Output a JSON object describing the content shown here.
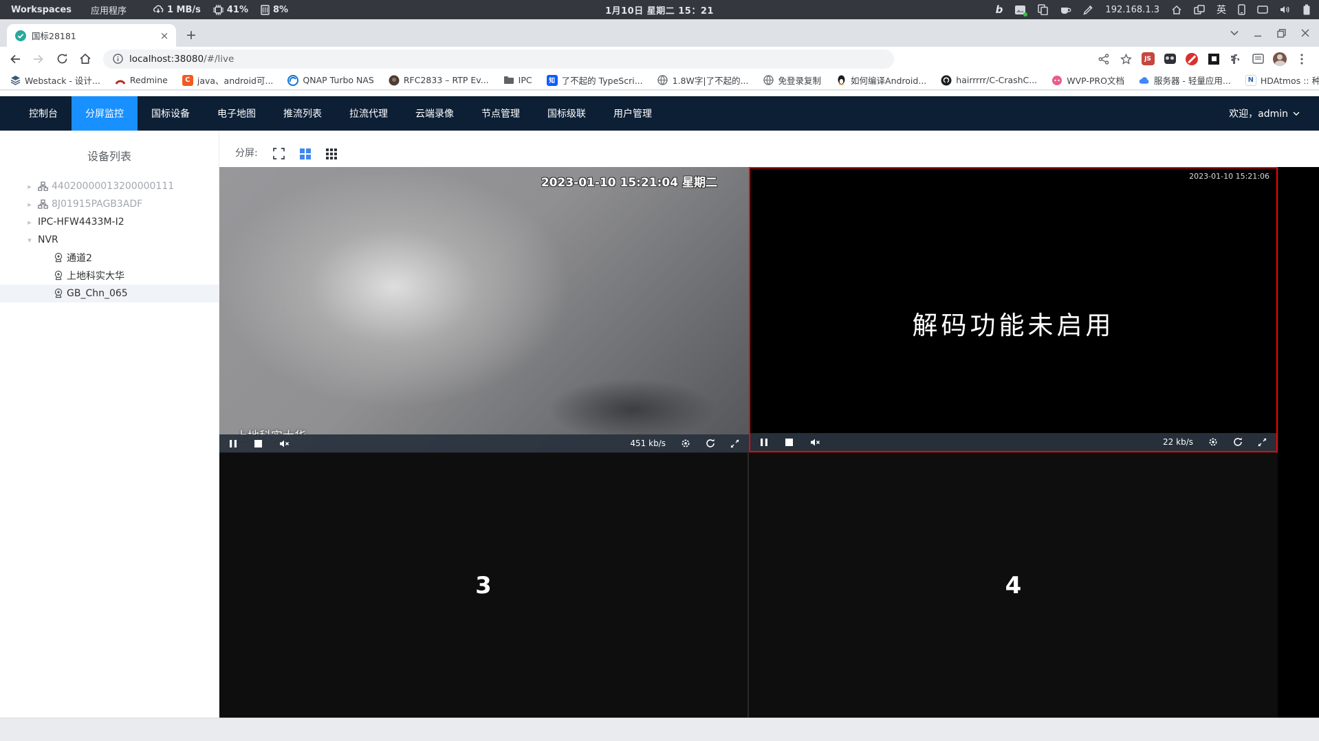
{
  "system_bar": {
    "workspaces_label": "Workspaces",
    "applications_label": "应用程序",
    "network_rate": "1 MB/s",
    "cpu_usage": "41%",
    "memory_usage": "8%",
    "clock": "1月10日 星期二 15：21",
    "ip_address": "192.168.1.3",
    "input_method_badge": "英"
  },
  "browser": {
    "tab_title": "国标28181",
    "new_tab_label": "+",
    "url_host": "localhost:38080",
    "url_path": "/#/live",
    "js_extension_badge": "JS",
    "bookmarks_overflow": "»"
  },
  "bookmarks": [
    "Webstack - 设计...",
    "Redmine",
    "java、android可...",
    "QNAP Turbo NAS",
    "RFC2833 – RTP Ev...",
    "IPC",
    "了不起的 TypeScri...",
    "1.8W字|了不起的...",
    "免登录复制",
    "如何编译Android...",
    "hairrrrr/C-CrashC...",
    "WVP-PRO文档",
    "服务器 - 轻量应用...",
    "HDAtmos :: 种子 *..."
  ],
  "bookmark_icon_letters": {
    "c_icon": "C",
    "zhihu_icon": "知",
    "nexus_icon": "N"
  },
  "nav": {
    "tabs": [
      "控制台",
      "分屏监控",
      "国标设备",
      "电子地图",
      "推流列表",
      "拉流代理",
      "云端录像",
      "节点管理",
      "国标级联",
      "用户管理"
    ],
    "active_tab": "分屏监控",
    "welcome": "欢迎，admin"
  },
  "sidebar": {
    "title": "设备列表",
    "tree": [
      "44020000013200000111",
      "8J01915PAGB3ADF",
      "IPC-HFW4433M-I2",
      "NVR",
      "通道2",
      "上地科实大华",
      "GB_Chn_065"
    ],
    "selected_item": "GB_Chn_065"
  },
  "screen_toolbar": {
    "label": "分屏:"
  },
  "players": {
    "p1": {
      "osd_timestamp": "2023-01-10 15:21:04 星期二",
      "camera_name": "上地科实大华",
      "bitrate": "451 kb/s"
    },
    "p2": {
      "osd_timestamp": "2023-01-10 15:21:06",
      "message": "解码功能未启用",
      "bitrate": "22 kb/s"
    },
    "p3": {
      "index": "3"
    },
    "p4": {
      "index": "4"
    }
  },
  "icons": {
    "tab_favicon": "teal-circle-check",
    "split_modes": [
      "fullscreen-brackets",
      "grid-2x2",
      "grid-3x3"
    ],
    "player_left_controls": [
      "pause",
      "stop",
      "volume-muted"
    ],
    "player_right_controls": [
      "settings-gear",
      "refresh",
      "fullscreen-expand"
    ]
  },
  "colors": {
    "accent_blue": "#1890ff",
    "selection_red": "#ff0000",
    "nav_background": "#0d1f35",
    "favicon_teal": "#27a99c"
  }
}
